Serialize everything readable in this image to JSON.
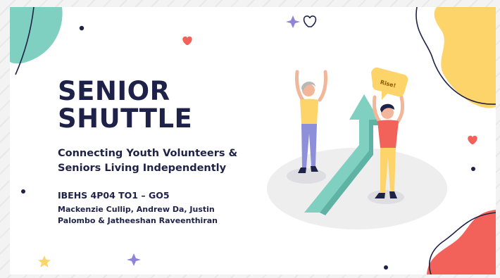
{
  "slide": {
    "title_line1": "SENIOR",
    "title_line2": "SHUTTLE",
    "subtitle_line1": "Connecting Youth Volunteers &",
    "subtitle_line2": "Seniors Living Independently",
    "course": "IBEHS 4P04 TO1 – GO5",
    "authors_line1": "Mackenzie Cullip, Andrew Da, Justin",
    "authors_line2": "Palombo & Jatheeshan Raveenthiran",
    "bubble_text": "Rise!"
  },
  "colors": {
    "navy": "#1f2248",
    "teal": "#7fd0c1",
    "yellow": "#fdd46a",
    "coral": "#f2625a",
    "purple": "#8d83d9"
  },
  "icons": [
    "heart-outline-icon",
    "heart-icon",
    "sparkle-icon",
    "star-icon",
    "dot-icon"
  ]
}
